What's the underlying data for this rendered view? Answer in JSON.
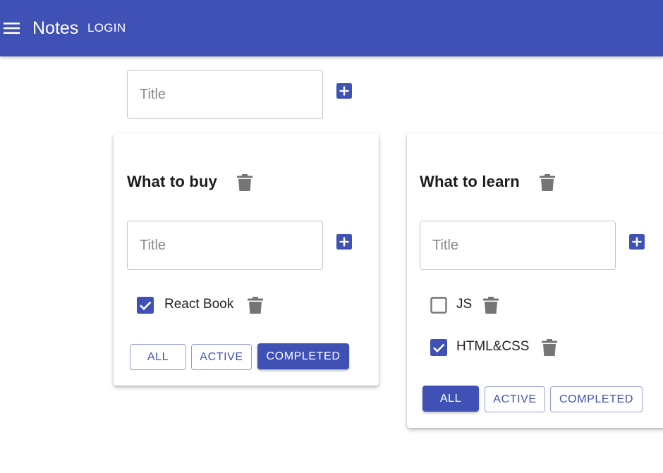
{
  "appbar": {
    "title": "Notes",
    "login_label": "LOGIN"
  },
  "new_list": {
    "placeholder": "Title",
    "value": ""
  },
  "lists": [
    {
      "title": "What to buy",
      "input_placeholder": "Title",
      "items": [
        {
          "label": "React Book",
          "checked": true
        }
      ],
      "filters": [
        "ALL",
        "ACTIVE",
        "COMPLETED"
      ],
      "active_filter": "COMPLETED"
    },
    {
      "title": "What to learn",
      "input_placeholder": "Title",
      "items": [
        {
          "label": "JS",
          "checked": false
        },
        {
          "label": "HTML&CSS",
          "checked": true
        }
      ],
      "filters": [
        "ALL",
        "ACTIVE",
        "COMPLETED"
      ],
      "active_filter": "ALL"
    }
  ],
  "colors": {
    "primary": "#3f51b5",
    "icon_gray": "#757575",
    "checkbox_off": "#757575"
  },
  "icons": {
    "menu": "menu-icon",
    "add": "add-box-icon",
    "delete": "trash-icon",
    "check": "checkbox-checked-icon"
  }
}
